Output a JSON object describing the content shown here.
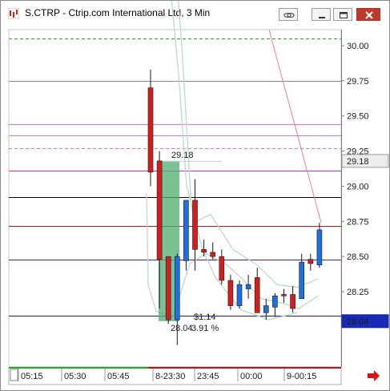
{
  "window": {
    "title": "S.CTRP - Ctrip.com International Ltd, 3 Min",
    "icons": [
      "app-chart-icon",
      "link-icon",
      "minimize-icon",
      "maximize-icon",
      "close-icon"
    ],
    "close_color": "#c0392b"
  },
  "chart_data": {
    "type": "candlestick",
    "symbol": "S.CTRP",
    "interval": "3 Min",
    "ylim": [
      27.85,
      30.1
    ],
    "yticks": [
      "30.00",
      "29.75",
      "29.50",
      "29.25",
      "29.00",
      "28.75",
      "28.50",
      "28.25"
    ],
    "last_price_label": "29.18",
    "bottom_price_label": "28.04",
    "x_time_labels": [
      "05:15",
      "05:30",
      "05:45",
      "8-23:30",
      "23:45",
      "00:00",
      "9-00:15"
    ],
    "candles": [
      {
        "open": 29.7,
        "high": 29.83,
        "low": 29.0,
        "close": 29.1
      },
      {
        "open": 29.18,
        "high": 29.25,
        "low": 28.13,
        "close": 28.48
      },
      {
        "open": 28.5,
        "high": 28.5,
        "low": 28.02,
        "close": 28.05
      },
      {
        "open": 28.05,
        "high": 28.52,
        "low": 27.87,
        "close": 28.5
      },
      {
        "open": 28.47,
        "high": 28.6,
        "low": 28.4,
        "close": 28.9
      },
      {
        "open": 28.9,
        "high": 29.05,
        "low": 28.4,
        "close": 28.55
      },
      {
        "open": 28.55,
        "high": 28.62,
        "low": 28.5,
        "close": 28.53
      },
      {
        "open": 28.53,
        "high": 28.6,
        "low": 28.48,
        "close": 28.5
      },
      {
        "open": 28.5,
        "high": 28.55,
        "low": 28.3,
        "close": 28.33
      },
      {
        "open": 28.33,
        "high": 28.37,
        "low": 28.12,
        "close": 28.15
      },
      {
        "open": 28.15,
        "high": 28.33,
        "low": 28.13,
        "close": 28.3
      },
      {
        "open": 28.27,
        "high": 28.37,
        "low": 28.2,
        "close": 28.3
      },
      {
        "open": 28.35,
        "high": 28.42,
        "low": 28.1,
        "close": 28.1
      },
      {
        "open": 28.1,
        "high": 28.2,
        "low": 28.05,
        "close": 28.15
      },
      {
        "open": 28.14,
        "high": 28.24,
        "low": 28.07,
        "close": 28.22
      },
      {
        "open": 28.23,
        "high": 28.27,
        "low": 28.17,
        "close": 28.22
      },
      {
        "open": 28.23,
        "high": 28.29,
        "low": 28.1,
        "close": 28.13
      },
      {
        "open": 28.2,
        "high": 28.52,
        "low": 28.2,
        "close": 28.46
      },
      {
        "open": 28.48,
        "high": 28.52,
        "low": 28.4,
        "close": 28.45
      },
      {
        "open": 28.44,
        "high": 28.74,
        "low": 28.42,
        "close": 28.69
      }
    ],
    "bull_color": "#1e6fe0",
    "bear_color": "#d41e1e",
    "levels": [
      {
        "price": 30.05,
        "color": "#22aa22",
        "dash": true
      },
      {
        "price": 29.75,
        "color": "#8c8c8c",
        "dash": false
      },
      {
        "price": 29.44,
        "color": "#e26fe2",
        "dash": false
      },
      {
        "price": 29.36,
        "color": "#e26fe2",
        "dash": false
      },
      {
        "price": 29.27,
        "color": "#e26fe2",
        "dash": true
      },
      {
        "price": 29.11,
        "color": "#cc33cc",
        "dash": false
      },
      {
        "price": 28.92,
        "color": "#000000",
        "dash": false
      },
      {
        "price": 28.72,
        "color": "#b21818",
        "dash": false
      },
      {
        "price": 28.48,
        "color": "#6a1a88",
        "dash": false
      },
      {
        "price": 28.08,
        "color": "#1a1aa8",
        "dash": false
      }
    ],
    "measure_tool": {
      "label_top": "29.18",
      "label_change": "$1.14",
      "label_low": "28.04",
      "label_pct": "3.91 %",
      "fill_color": "#4cae6e",
      "text_color": "#1e8ff0"
    },
    "envelope_color": "#b8dcc4",
    "trendline_color": "#f07ab8",
    "navigation_icon": "right-arrow-icon",
    "navigation_color": "#e01010"
  }
}
